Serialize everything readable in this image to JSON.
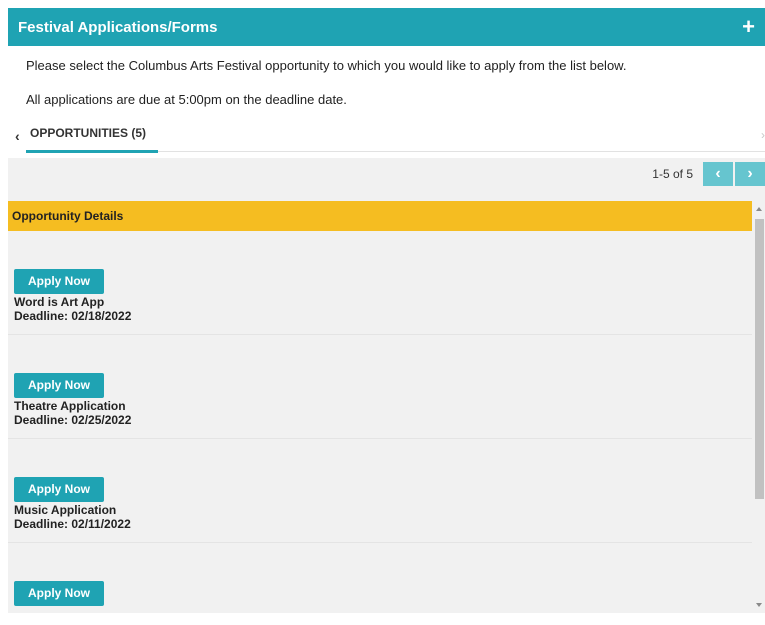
{
  "header": {
    "title": "Festival Applications/Forms",
    "add_icon": "+"
  },
  "intro": {
    "line1": "Please select the Columbus Arts Festival opportunity to which you would like to apply from the list below.",
    "line2": "All applications are due at 5:00pm on the deadline date."
  },
  "tabs": {
    "left_icon": "‹",
    "label": "OPPORTUNITIES (5)",
    "right_icon": "›"
  },
  "pager": {
    "text": "1-5 of 5",
    "prev_icon": "‹",
    "next_icon": "›"
  },
  "table": {
    "header": "Opportunity Details"
  },
  "items": [
    {
      "button": "Apply Now",
      "name": "Word is Art App",
      "deadline": "Deadline: 02/18/2022"
    },
    {
      "button": "Apply Now",
      "name": "Theatre Application",
      "deadline": "Deadline: 02/25/2022"
    },
    {
      "button": "Apply Now",
      "name": "Music Application",
      "deadline": "Deadline: 02/11/2022"
    },
    {
      "button": "Apply Now",
      "name": "",
      "deadline": ""
    }
  ],
  "colors": {
    "accent": "#1fa3b3",
    "table_header": "#f5bd21",
    "pager_button": "#66c5cf"
  }
}
